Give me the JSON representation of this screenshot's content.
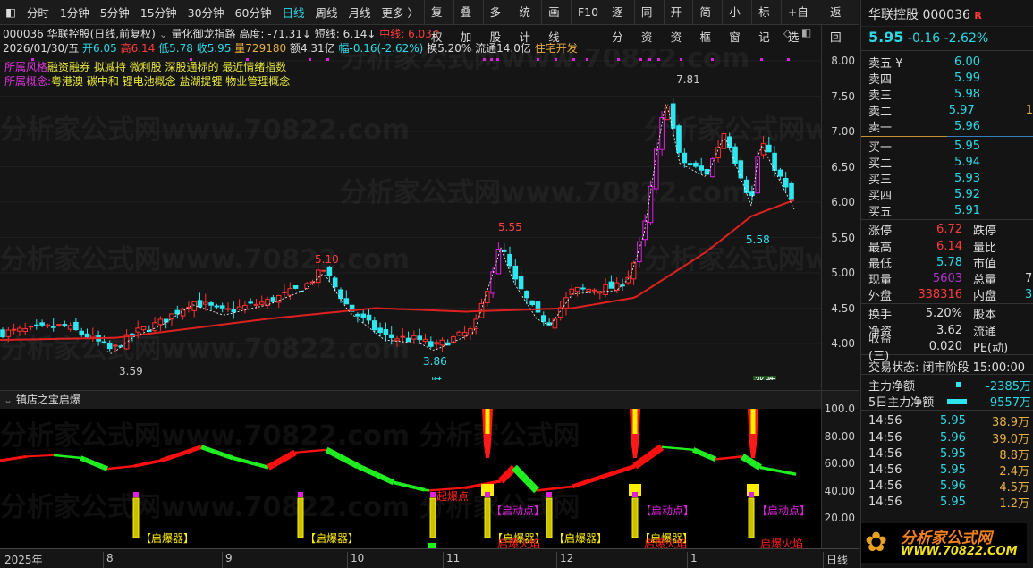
{
  "toolbar": {
    "periods": [
      "分时",
      "1分钟",
      "5分钟",
      "15分钟",
      "30分钟",
      "60分钟",
      "日线",
      "周线",
      "月线",
      "更多 〉"
    ],
    "active_period": "日线",
    "actions": [
      "复权",
      "叠加",
      "多股",
      "统计",
      "画线",
      "F10",
      "逐分",
      "同资",
      "开资",
      "简框",
      "小窗",
      "标记",
      "+自选",
      "返回"
    ]
  },
  "info": {
    "title": "000036 华联控股(日线,前复权)",
    "indicator": "量化御龙指路",
    "height_label": "高度: -71.31↓",
    "short_label": "短线: 6.14↓",
    "mid_label": "中线: 6.03↑",
    "date": "2026/01/30/五",
    "open": "开6.05",
    "high": "高6.14",
    "low": "低5.78",
    "close": "收5.95",
    "volume": "量729180",
    "amount": "额4.31亿",
    "change": "幅-0.16(-2.62%)",
    "turnover": "换5.20%",
    "float": "流通14.0亿",
    "industry": "住宅开发"
  },
  "tags": {
    "style_label": "所属风格",
    "style_items": "融资融券 拟减持 微利股 深股通标的 最近情绪指数",
    "concept_label": "所属概念:",
    "concept_items": "粤港澳 碳中和 锂电池概念 盐湖提锂 物业管理概念"
  },
  "price_axis": [
    "8.00",
    "7.50",
    "7.00",
    "6.50",
    "6.00",
    "5.50",
    "5.00",
    "4.50",
    "4.00"
  ],
  "annotations": {
    "high1": "5.10",
    "low1": "3.59",
    "low2": "3.86",
    "high2": "5.55",
    "peak": "7.81",
    "low3": "5.58",
    "fin_marker": "财",
    "limit_marker": "涨跌"
  },
  "price_path": [
    [
      0,
      4.15
    ],
    [
      40,
      4.2
    ],
    [
      70,
      4.25
    ],
    [
      100,
      4.1
    ],
    [
      125,
      3.9
    ],
    [
      150,
      4.15
    ],
    [
      180,
      4.3
    ],
    [
      215,
      4.6
    ],
    [
      250,
      4.45
    ],
    [
      300,
      4.6
    ],
    [
      340,
      4.8
    ],
    [
      362,
      5.05
    ],
    [
      390,
      4.5
    ],
    [
      430,
      4.1
    ],
    [
      470,
      4.05
    ],
    [
      485,
      3.95
    ],
    [
      530,
      4.2
    ],
    [
      560,
      5.4
    ],
    [
      575,
      4.9
    ],
    [
      600,
      4.4
    ],
    [
      615,
      4.3
    ],
    [
      640,
      4.75
    ],
    [
      690,
      4.8
    ],
    [
      705,
      5.0
    ],
    [
      720,
      5.6
    ],
    [
      735,
      6.8
    ],
    [
      745,
      7.5
    ],
    [
      760,
      6.6
    ],
    [
      790,
      6.4
    ],
    [
      810,
      7.0
    ],
    [
      840,
      6.0
    ],
    [
      850,
      6.9
    ],
    [
      862,
      6.6
    ],
    [
      888,
      5.95
    ]
  ],
  "ma_path": [
    [
      0,
      4.05
    ],
    [
      130,
      4.08
    ],
    [
      300,
      4.35
    ],
    [
      420,
      4.5
    ],
    [
      520,
      4.45
    ],
    [
      640,
      4.5
    ],
    [
      710,
      4.65
    ],
    [
      790,
      5.3
    ],
    [
      840,
      5.8
    ],
    [
      888,
      6.03
    ]
  ],
  "indicator": {
    "name": "镇店之宝启爆",
    "axis": [
      "100.0",
      "80.00",
      "60.00",
      "40.00",
      "20.00"
    ],
    "line_path": [
      [
        0,
        62
      ],
      [
        30,
        65
      ],
      [
        60,
        66
      ],
      [
        90,
        64
      ],
      [
        120,
        56
      ],
      [
        150,
        58
      ],
      [
        180,
        62
      ],
      [
        225,
        72
      ],
      [
        260,
        64
      ],
      [
        300,
        57
      ],
      [
        330,
        68
      ],
      [
        365,
        70
      ],
      [
        400,
        58
      ],
      [
        440,
        46
      ],
      [
        478,
        40
      ],
      [
        520,
        42
      ],
      [
        560,
        47
      ],
      [
        575,
        57
      ],
      [
        600,
        40
      ],
      [
        640,
        43
      ],
      [
        710,
        58
      ],
      [
        740,
        72
      ],
      [
        775,
        70
      ],
      [
        800,
        63
      ],
      [
        830,
        65
      ],
      [
        850,
        57
      ],
      [
        890,
        52
      ]
    ],
    "bombers": [
      152,
      336,
      484,
      545,
      614,
      710,
      840
    ],
    "flames": [
      545,
      710,
      842
    ],
    "labels": {
      "detonator": "【启爆器】",
      "start": "【启动点】",
      "burst": "起爆点",
      "flame": "启爆火焰"
    }
  },
  "xaxis": {
    "labels": [
      "2025年",
      "8",
      "9",
      "10",
      "11",
      "12",
      "1"
    ],
    "mode": "日线"
  },
  "quote": {
    "name": "华联控股 000036",
    "r": "R",
    "price": "5.95",
    "change": "-0.16",
    "pct": "-2.62%",
    "asks": [
      [
        "卖五 ¥",
        "6.00"
      ],
      [
        "卖四",
        "5.99"
      ],
      [
        "卖三",
        "5.98"
      ],
      [
        "卖二",
        "5.97"
      ],
      [
        "卖一",
        "5.96"
      ]
    ],
    "bids": [
      [
        "买一",
        "5.95"
      ],
      [
        "买二",
        "5.94"
      ],
      [
        "买三",
        "5.93"
      ],
      [
        "买四",
        "5.92"
      ],
      [
        "买五",
        "5.91"
      ]
    ],
    "ask2_vol": "1",
    "stats": [
      [
        "涨停",
        "6.72",
        "跌停",
        ""
      ],
      [
        "最高",
        "6.14",
        "量比",
        ""
      ],
      [
        "最低",
        "5.78",
        "市值",
        ""
      ],
      [
        "现量",
        "5603",
        "总量",
        "7"
      ],
      [
        "外盘",
        "338316",
        "内盘",
        "3"
      ]
    ],
    "stats2": [
      [
        "换手",
        "5.20%",
        "股本"
      ],
      [
        "净资",
        "3.62",
        "流通"
      ],
      [
        "收益(三)",
        "0.020",
        "PE(动)"
      ]
    ],
    "status": "交易状态: 闭市阶段 15:00:00",
    "flow": [
      [
        "主力净额",
        "-2385万"
      ],
      [
        "5日主力净额",
        "-9557万"
      ]
    ],
    "trades": [
      [
        "14:56",
        "5.95",
        "38.9万"
      ],
      [
        "14:56",
        "5.96",
        "39.0万"
      ],
      [
        "14:56",
        "5.95",
        "8.8万"
      ],
      [
        "14:56",
        "5.95",
        "2.4万"
      ],
      [
        "14:56",
        "5.96",
        "4.5万"
      ],
      [
        "14:56",
        "5.95",
        "1.2万"
      ]
    ]
  },
  "logo": {
    "name": "分析家公式网",
    "url": "WWW.70822.COM"
  },
  "colors": {
    "up": "#ff3030",
    "down": "#2de6f0",
    "ma": "#e02020",
    "rise": "#ff1010",
    "fall": "#20f020"
  }
}
